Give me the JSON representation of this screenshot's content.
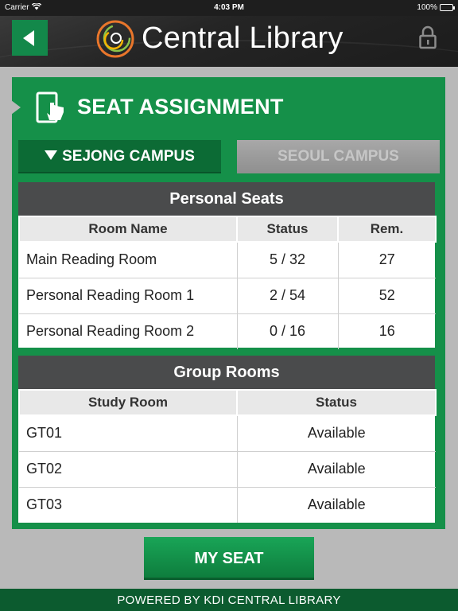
{
  "status_bar": {
    "carrier": "Carrier",
    "wifi_icon": "wifi-icon",
    "time": "4:03 PM",
    "battery": "100%",
    "battery_level": 1.0
  },
  "header": {
    "title": "Central Library",
    "back_icon": "back-arrow-icon",
    "lock_icon": "lock-icon",
    "logo": "library-logo"
  },
  "section": {
    "title": "SEAT ASSIGNMENT",
    "icon": "tablet-touch-icon"
  },
  "tabs": [
    {
      "label": "SEJONG CAMPUS",
      "active": true
    },
    {
      "label": "SEOUL CAMPUS",
      "active": false
    }
  ],
  "personal_seats": {
    "title": "Personal Seats",
    "columns": [
      "Room Name",
      "Status",
      "Rem."
    ],
    "rows": [
      [
        "Main Reading Room",
        "5 / 32",
        "27"
      ],
      [
        "Personal Reading Room 1",
        "2 / 54",
        "52"
      ],
      [
        "Personal Reading Room 2",
        "0 / 16",
        "16"
      ]
    ]
  },
  "group_rooms": {
    "title": "Group Rooms",
    "columns": [
      "Study Room",
      "Status"
    ],
    "rows": [
      [
        "GT01",
        "Available"
      ],
      [
        "GT02",
        "Available"
      ],
      [
        "GT03",
        "Available"
      ]
    ]
  },
  "my_seat_button": "MY SEAT",
  "footer": "POWERED BY KDI CENTRAL LIBRARY",
  "colors": {
    "brand_green": "#159049",
    "dark_green": "#0c6b35",
    "header_dark": "#252525",
    "section_head": "#4a4b4c"
  }
}
